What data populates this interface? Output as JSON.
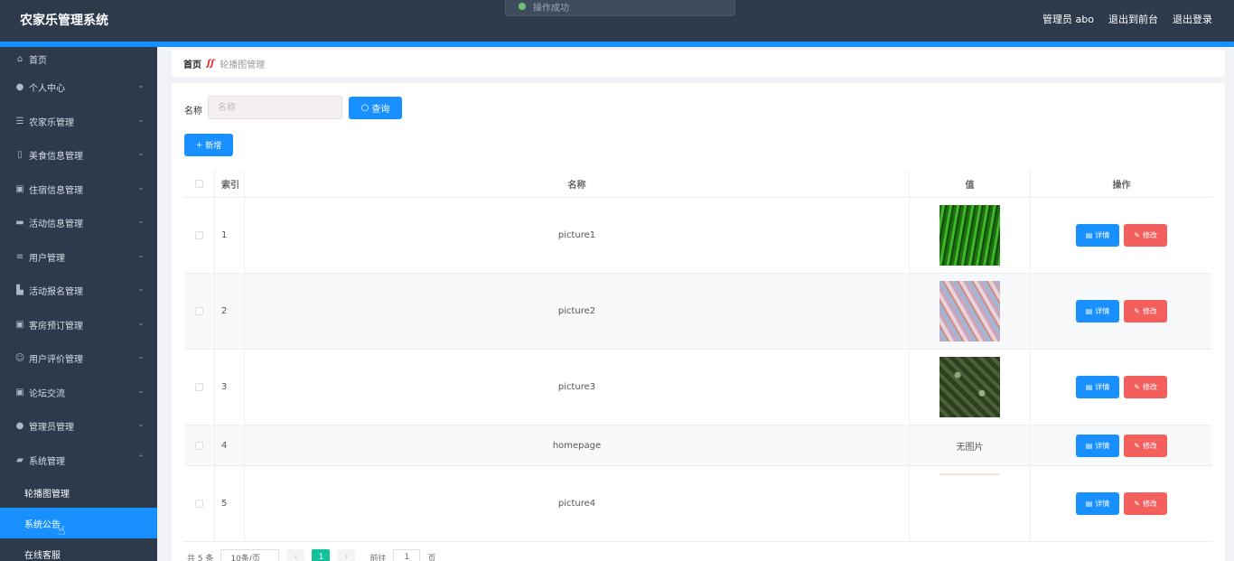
{
  "header": {
    "title": "农家乐管理系统",
    "toast": "操作成功",
    "admin": "管理员 abo",
    "to_front": "退出到前台",
    "logout": "退出登录"
  },
  "sidebar": {
    "items": [
      {
        "label": "首页",
        "icon": "home-icon"
      },
      {
        "label": "个人中心",
        "icon": "user-icon"
      },
      {
        "label": "农家乐管理",
        "icon": "list-icon"
      },
      {
        "label": "美食信息管理",
        "icon": "mic-icon"
      },
      {
        "label": "住宿信息管理",
        "icon": "clipboard-icon"
      },
      {
        "label": "活动信息管理",
        "icon": "briefcase-icon"
      },
      {
        "label": "用户管理",
        "icon": "sliders-icon"
      },
      {
        "label": "活动报名管理",
        "icon": "chart-icon"
      },
      {
        "label": "客房预订管理",
        "icon": "clipboard-icon"
      },
      {
        "label": "用户评价管理",
        "icon": "smile-icon"
      },
      {
        "label": "论坛交流",
        "icon": "clipboard-icon"
      },
      {
        "label": "管理员管理",
        "icon": "user-icon"
      },
      {
        "label": "系统管理",
        "icon": "chat-icon"
      }
    ],
    "sub_items": [
      {
        "label": "轮播图管理"
      },
      {
        "label": "系统公告"
      },
      {
        "label": "在线客服"
      }
    ]
  },
  "breadcrumb": {
    "home": "首页",
    "current": "轮播图管理"
  },
  "search": {
    "label": "名称",
    "placeholder": "名称",
    "query_button": "查询",
    "add_button": "新增"
  },
  "table": {
    "headers": {
      "index": "索引",
      "name": "名称",
      "value": "值",
      "ops": "操作"
    },
    "rows": [
      {
        "index": "1",
        "name": "picture1",
        "value": "",
        "detail": "详情",
        "edit": "修改"
      },
      {
        "index": "2",
        "name": "picture2",
        "value": "",
        "detail": "详情",
        "edit": "修改"
      },
      {
        "index": "3",
        "name": "picture3",
        "value": "",
        "detail": "详情",
        "edit": "修改"
      },
      {
        "index": "4",
        "name": "homepage",
        "value": "无图片",
        "detail": "详情",
        "edit": "修改"
      },
      {
        "index": "5",
        "name": "picture4",
        "value": "",
        "detail": "详情",
        "edit": "修改"
      }
    ]
  },
  "pager": {
    "total": "共 5 条",
    "page_size": "10条/页",
    "current": "1",
    "goto_prefix": "前往",
    "goto_value": "1",
    "goto_suffix": "页"
  },
  "colors": {
    "header_bg": "#2d3a4b",
    "accent": "#1890ff",
    "edit": "#f25f5c",
    "page_active": "#13c29a"
  }
}
